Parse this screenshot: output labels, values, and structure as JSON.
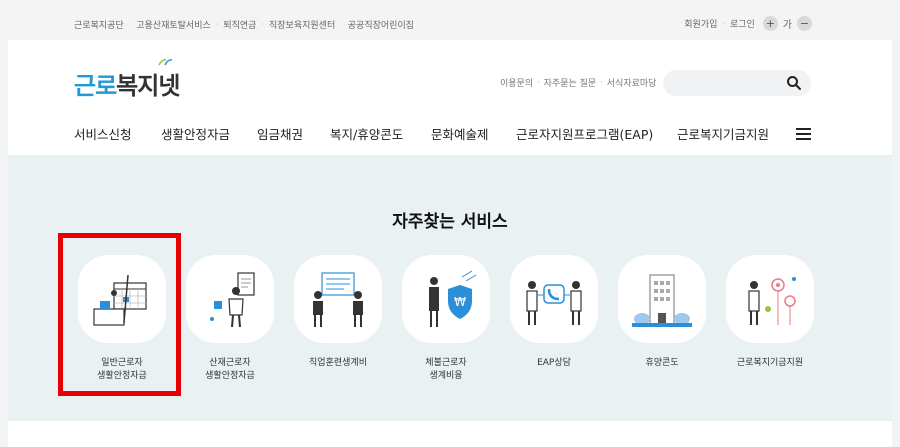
{
  "utility": {
    "links": [
      "근로복지공단",
      "고용산재토탈서비스",
      "퇴직연금",
      "직장보육지원센터",
      "공공직장어린이집"
    ],
    "join": "회원가입",
    "login": "로그인",
    "font_increase": "+",
    "font_label": "가",
    "font_decrease": "−"
  },
  "logo": {
    "part1": "근로",
    "part2": "복지넷"
  },
  "header_links": [
    "이용문의",
    "자주묻는 질문",
    "서식자료마당"
  ],
  "search": {
    "placeholder": "",
    "icon": "search-icon"
  },
  "nav": [
    "서비스신청",
    "생활안정자금",
    "임금채권",
    "복지/휴양콘도",
    "문화예술제",
    "근로자지원프로그램(EAP)",
    "근로복지기금지원"
  ],
  "services": {
    "title": "자주찾는 서비스",
    "items": [
      {
        "line1": "일반근로자",
        "line2": "생활안정자금",
        "icon": "calendar-person-icon"
      },
      {
        "line1": "산재근로자",
        "line2": "생활안정자금",
        "icon": "document-person-icon"
      },
      {
        "line1": "직업훈련생계비",
        "line2": "",
        "icon": "presentation-icon"
      },
      {
        "line1": "체불근로자",
        "line2": "생계비융",
        "icon": "won-shield-icon"
      },
      {
        "line1": "EAP상담",
        "line2": "",
        "icon": "phone-counsel-icon"
      },
      {
        "line1": "휴양콘도",
        "line2": "",
        "icon": "building-icon"
      },
      {
        "line1": "근로복지기금지원",
        "line2": "",
        "icon": "flower-person-icon"
      }
    ]
  },
  "colors": {
    "brand_blue": "#1f9ad6",
    "section_bg": "#eaf1f3",
    "highlight_red": "#e60000"
  }
}
